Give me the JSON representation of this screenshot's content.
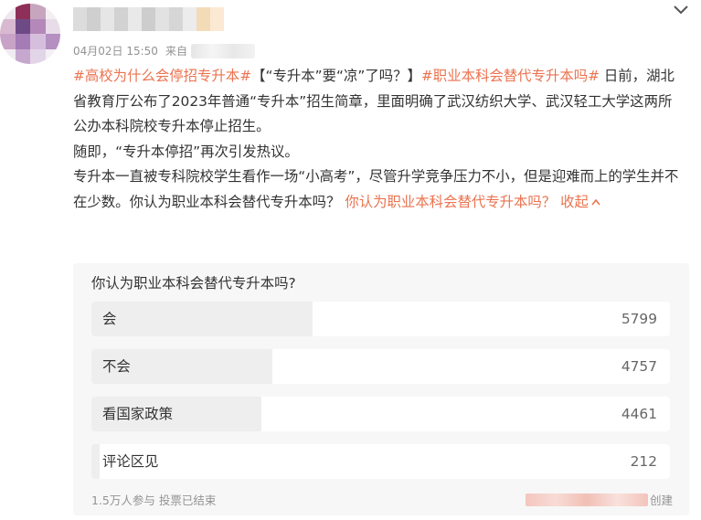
{
  "post": {
    "timestamp": "04月02日 15:50",
    "source_prefix": "来自",
    "paragraphs": [
      [
        {
          "text": "#高校为什么会停招专升本#",
          "tag": true
        },
        {
          "text": "【“专升本”要“凉”了吗？】",
          "tag": false
        },
        {
          "text": "#职业本科会替代专升本吗#",
          "tag": true
        },
        {
          "text": " 日前，湖北省教育厅公布了2023年普通“专升本”招生简章，里面明确了武汉纺织大学、武汉轻工大学这两所公办本科院校专升本停止招生。",
          "tag": false
        }
      ],
      [
        {
          "text": "随即，“专升本停招”再次引发热议。",
          "tag": false
        }
      ],
      [
        {
          "text": "专升本一直被专科院校学生看作一场“小高考”，尽管升学竞争压力不小，但是迎难而上的学生并不在少数。你认为职业本科会替代专升本吗？ ",
          "tag": false
        },
        {
          "text": "你认为职业本科会替代专升本吗？",
          "tag": true
        }
      ]
    ],
    "collapse_label": "收起"
  },
  "poll": {
    "question": "你认为职业本科会替代专升本吗?",
    "options": [
      {
        "label": "会",
        "count": "5799",
        "share": 0.3816
      },
      {
        "label": "不会",
        "count": "4757",
        "share": 0.313
      },
      {
        "label": "看国家政策",
        "count": "4461",
        "share": 0.2936
      },
      {
        "label": "评论区见",
        "count": "212",
        "share": 0.014
      }
    ],
    "footer": "1.5万人参与 投票已结束",
    "creator_suffix": "创建"
  },
  "colors": {
    "accent": "#eb7350",
    "muted": "#939393",
    "poll_bg": "#f7f7f7",
    "bar_fill": "#eeeeee"
  },
  "icons": [
    "chevron-down-icon",
    "chevron-up-icon"
  ]
}
